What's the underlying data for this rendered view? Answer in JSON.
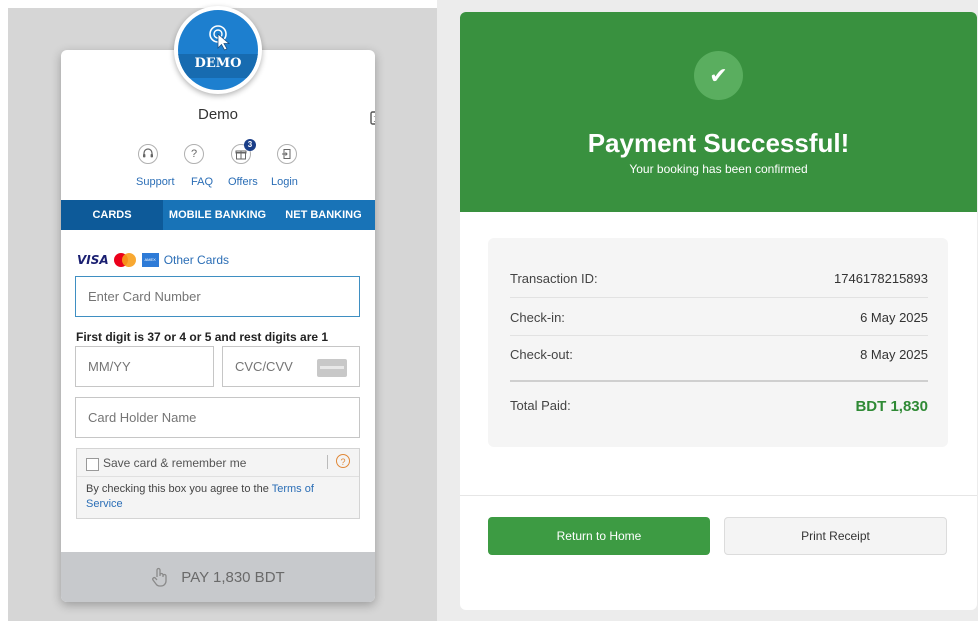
{
  "widget": {
    "logo_text": "DEMO",
    "merchant_name": "Demo",
    "icons": [
      {
        "name": "support-icon",
        "label": "Support"
      },
      {
        "name": "faq-icon",
        "label": "FAQ"
      },
      {
        "name": "offers-icon",
        "label": "Offers",
        "badge": "3"
      },
      {
        "name": "login-icon",
        "label": "Login"
      }
    ],
    "tabs": [
      "CARDS",
      "MOBILE BANKING",
      "NET BANKING"
    ],
    "active_tab": "CARDS",
    "other_cards": "Other Cards",
    "card_number_placeholder": "Enter Card Number",
    "hint": "First digit is 37 or 4 or 5 and rest digits are 1",
    "expiry_placeholder": "MM/YY",
    "cvc_placeholder": "CVC/CVV",
    "holder_placeholder": "Card Holder Name",
    "save_label": "Save card & remember me",
    "terms_prefix": "By checking this box you agree to the ",
    "terms_link": "Terms of Service",
    "pay_button": "PAY 1,830 BDT"
  },
  "success": {
    "title": "Payment Successful!",
    "subtitle": "Your booking has been confirmed",
    "rows": [
      {
        "label": "Transaction ID:",
        "value": "1746178215893"
      },
      {
        "label": "Check-in:",
        "value": "6 May 2025"
      },
      {
        "label": "Check-out:",
        "value": "8 May 2025"
      }
    ],
    "total_label": "Total Paid:",
    "total_value": "BDT 1,830",
    "return_button": "Return to Home",
    "print_button": "Print Receipt"
  },
  "colors": {
    "brand_blue": "#1873b7",
    "success_green": "#39913f",
    "total_green": "#2f8a35"
  }
}
